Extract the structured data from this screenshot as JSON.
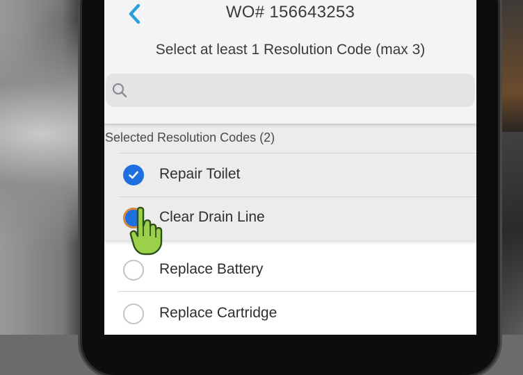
{
  "header": {
    "title": "WO# 156643253",
    "subtitle": "Select at least 1 Resolution Code (max 3)"
  },
  "search": {
    "placeholder": "",
    "value": ""
  },
  "selected_section": {
    "label": "Selected Resolution Codes (2)",
    "items": [
      {
        "label": "Repair Toilet",
        "checked": true
      },
      {
        "label": "Clear Drain Line",
        "checked": true
      }
    ]
  },
  "unselected_items": [
    {
      "label": "Replace Battery",
      "checked": false
    },
    {
      "label": "Replace Cartridge",
      "checked": false
    }
  ],
  "colors": {
    "accent": "#1f6fe0",
    "back_chevron": "#2a9fd8",
    "cursor_hand": "#8cc63f"
  },
  "icons": {
    "back": "chevron-left-icon",
    "search": "search-icon",
    "check": "checkmark-icon",
    "pointer": "hand-pointer-icon"
  }
}
